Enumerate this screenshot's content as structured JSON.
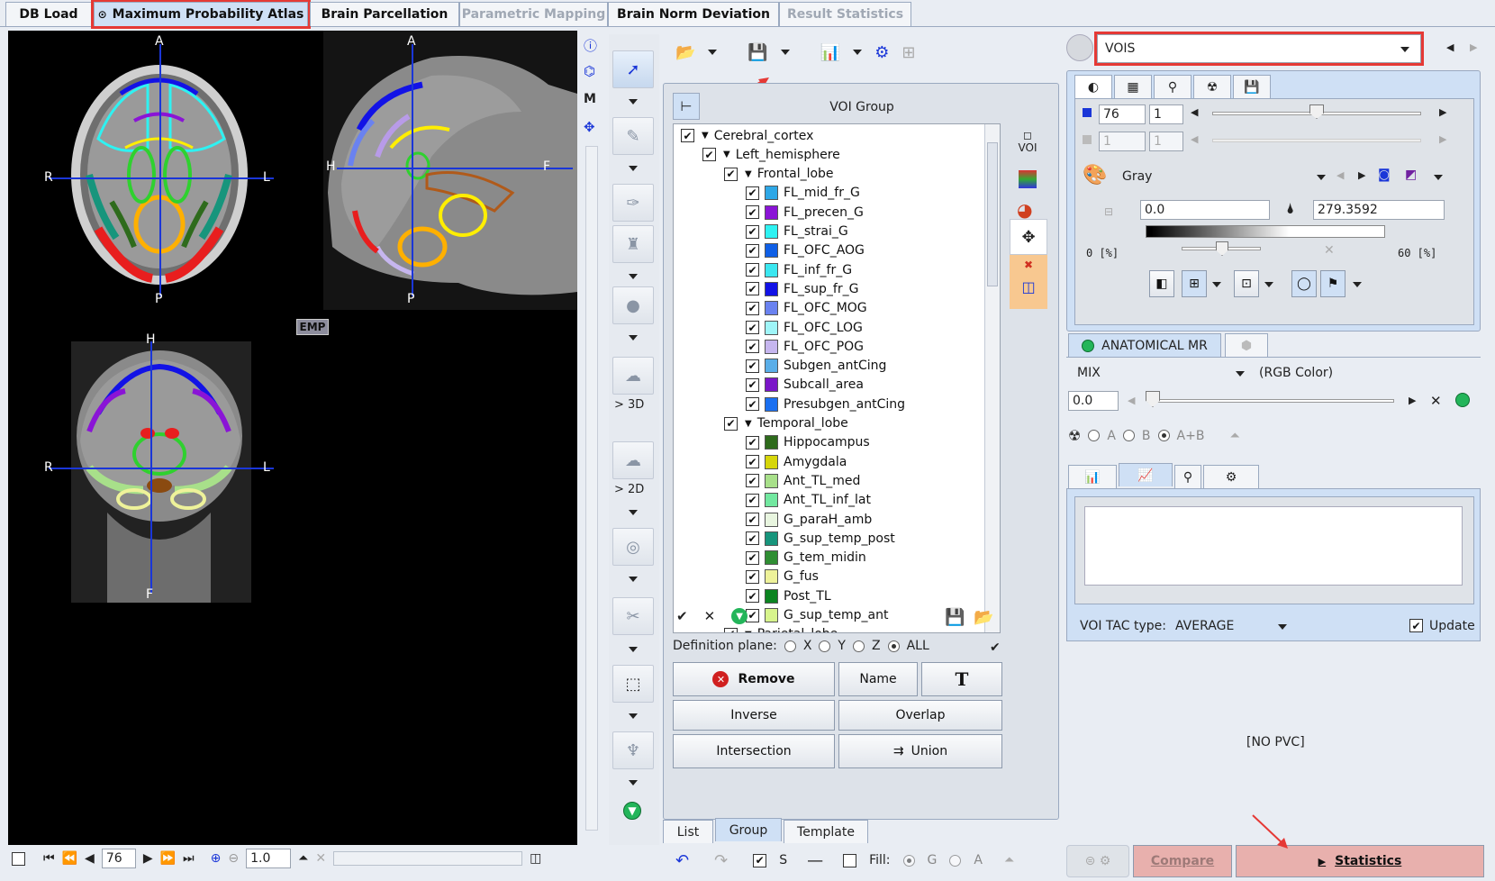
{
  "tabs": [
    {
      "label": "DB Load"
    },
    {
      "label": "Maximum Probability Atlas"
    },
    {
      "label": "Brain Parcellation"
    },
    {
      "label": "Parametric Mapping"
    },
    {
      "label": "Brain Norm Deviation"
    },
    {
      "label": "Result Statistics"
    }
  ],
  "viewer": {
    "axial": {
      "top": "A",
      "bottom": "P",
      "left": "R",
      "right": "L"
    },
    "sagittal": {
      "top": "A",
      "bottom": "P",
      "left": "H",
      "right": "F"
    },
    "coronal": {
      "top": "H",
      "bottom": "F",
      "left": "R",
      "right": "L"
    },
    "emp_label": "EMP",
    "slice_value": "76",
    "zoom_value": "1.0"
  },
  "side_tools": {
    "label_3d": "> 3D",
    "label_2d": "> 2D"
  },
  "voi_panel": {
    "group_title": "VOI Group",
    "tree": [
      {
        "label": "Cerebral_cortex",
        "level": 0,
        "expand": true
      },
      {
        "label": "Left_hemisphere",
        "level": 1,
        "expand": true
      },
      {
        "label": "Frontal_lobe",
        "level": 2,
        "expand": true
      },
      {
        "label": "FL_mid_fr_G",
        "level": 3,
        "color": "#2ea7e6"
      },
      {
        "label": "FL_precen_G",
        "level": 3,
        "color": "#8a14d6"
      },
      {
        "label": "FL_strai_G",
        "level": 3,
        "color": "#2ef2f2"
      },
      {
        "label": "FL_OFC_AOG",
        "level": 3,
        "color": "#0f5fe6"
      },
      {
        "label": "FL_inf_fr_G",
        "level": 3,
        "color": "#3be7f0"
      },
      {
        "label": "FL_sup_fr_G",
        "level": 3,
        "color": "#1212e6"
      },
      {
        "label": "FL_OFC_MOG",
        "level": 3,
        "color": "#6a82f0"
      },
      {
        "label": "FL_OFC_LOG",
        "level": 3,
        "color": "#9ff5f8"
      },
      {
        "label": "FL_OFC_POG",
        "level": 3,
        "color": "#c6b6ef"
      },
      {
        "label": "Subgen_antCing",
        "level": 3,
        "color": "#5aaee8"
      },
      {
        "label": "Subcall_area",
        "level": 3,
        "color": "#7a16c8"
      },
      {
        "label": "Presubgen_antCing",
        "level": 3,
        "color": "#1a6ff0"
      },
      {
        "label": "Temporal_lobe",
        "level": 2,
        "expand": true
      },
      {
        "label": "Hippocampus",
        "level": 3,
        "color": "#2e6b1c"
      },
      {
        "label": "Amygdala",
        "level": 3,
        "color": "#d6d60a"
      },
      {
        "label": "Ant_TL_med",
        "level": 3,
        "color": "#a8e08a"
      },
      {
        "label": "Ant_TL_inf_lat",
        "level": 3,
        "color": "#72e8a0"
      },
      {
        "label": "G_paraH_amb",
        "level": 3,
        "color": "#e8f5df"
      },
      {
        "label": "G_sup_temp_post",
        "level": 3,
        "color": "#17957c"
      },
      {
        "label": "G_tem_midin",
        "level": 3,
        "color": "#2f8e33"
      },
      {
        "label": "G_fus",
        "level": 3,
        "color": "#eef29a"
      },
      {
        "label": "Post_TL",
        "level": 3,
        "color": "#0b8420"
      },
      {
        "label": "G_sup_temp_ant",
        "level": 3,
        "color": "#d7f48c"
      },
      {
        "label": "Parietal_lobe",
        "level": 2,
        "expand": true
      }
    ],
    "definition_plane_label": "Definition plane:",
    "planes": [
      "X",
      "Y",
      "Z",
      "ALL"
    ],
    "selected_plane": "ALL",
    "buttons": {
      "remove": "Remove",
      "name": "Name",
      "t": "T",
      "inverse": "Inverse",
      "overlap": "Overlap",
      "intersection": "Intersection",
      "union": "Union"
    },
    "bottom_tabs": [
      "List",
      "Group",
      "Template"
    ],
    "active_bottom_tab": "Group"
  },
  "bottom_toolbar": {
    "s_label": "S",
    "fill_label": "Fill:",
    "g_label": "G",
    "a_label": "A"
  },
  "right": {
    "vois_select": "VOIS",
    "value1": "76",
    "value2": "1",
    "value3": "1",
    "value4": "1",
    "colormap": "Gray",
    "min": "0.0",
    "max": "279.3592",
    "pct_low": "0  [%]",
    "pct_high": "60  [%]",
    "anat_tab": "ANATOMICAL MR",
    "mix_label": "MIX",
    "rgb_label": "(RGB Color)",
    "mix_value": "0.0",
    "radio_a": "A",
    "radio_b": "B",
    "radio_ab": "A+B",
    "tac_label": "VOI TAC type:",
    "tac_value": "AVERAGE",
    "update_label": "Update",
    "no_pvc": "[NO PVC]",
    "compare": "Compare",
    "statistics": "Statistics"
  }
}
